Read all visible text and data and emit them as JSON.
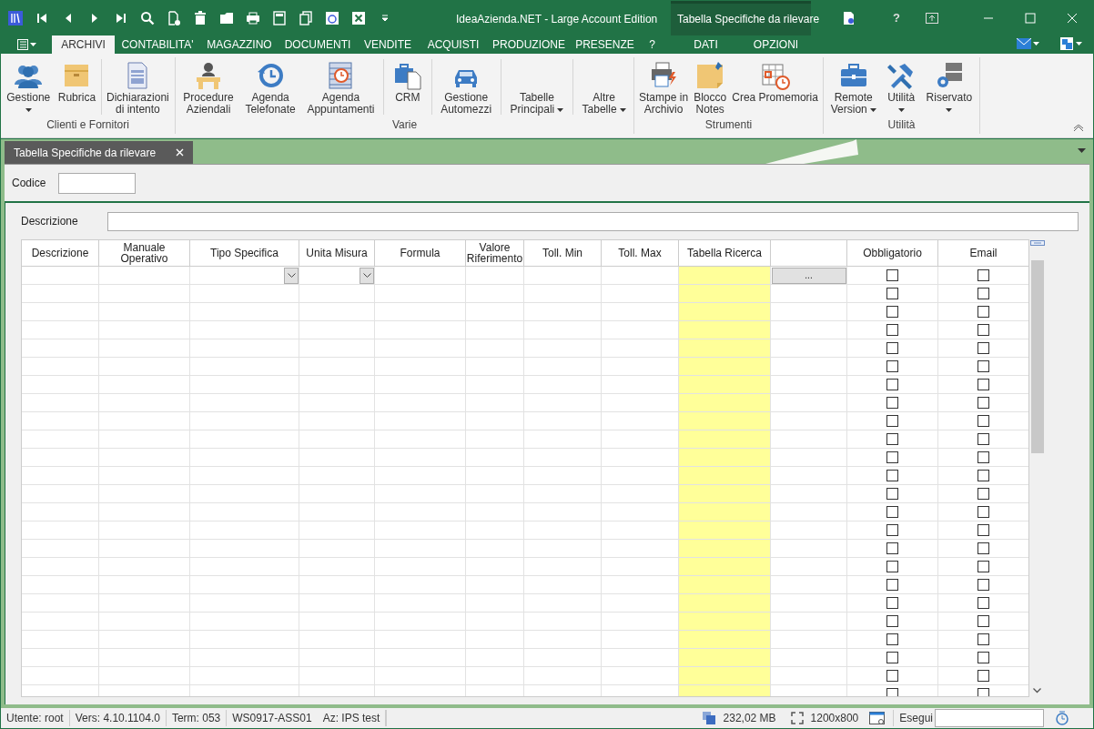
{
  "window": {
    "title": "IdeaAzienda.NET - Large Account Edition",
    "help": "?"
  },
  "context_tab_group": {
    "title": "Tabella Specifiche da rilevare",
    "tabs": [
      {
        "label": "DATI",
        "selected": false
      },
      {
        "label": "OPZIONI",
        "selected": false
      }
    ]
  },
  "ribbon_tabs": [
    {
      "label": "ARCHIVI",
      "selected": true
    },
    {
      "label": "CONTABILITA'",
      "selected": false
    },
    {
      "label": "MAGAZZINO",
      "selected": false
    },
    {
      "label": "DOCUMENTI",
      "selected": false
    },
    {
      "label": "VENDITE",
      "selected": false
    },
    {
      "label": "ACQUISTI",
      "selected": false
    },
    {
      "label": "PRODUZIONE",
      "selected": false
    },
    {
      "label": "PRESENZE",
      "selected": false
    },
    {
      "label": "?",
      "selected": false
    }
  ],
  "ribbon_groups": [
    {
      "label": "Clienti e Fornitori",
      "items": [
        {
          "lines": [
            "Gestione"
          ],
          "dropdown": true,
          "separated": false
        },
        {
          "lines": [
            "Rubrica"
          ],
          "dropdown": false,
          "separated": false
        },
        {
          "lines": [
            "Dichiarazioni",
            "di intento"
          ],
          "dropdown": false,
          "separated": true
        }
      ]
    },
    {
      "label": "Varie",
      "items": [
        {
          "lines": [
            "Procedure",
            "Aziendali"
          ],
          "dropdown": false,
          "separated": false
        },
        {
          "lines": [
            "Agenda",
            "Telefonate"
          ],
          "dropdown": false,
          "separated": false
        },
        {
          "lines": [
            "Agenda",
            "Appuntamenti"
          ],
          "dropdown": false,
          "separated": false
        },
        {
          "lines": [
            "CRM"
          ],
          "dropdown": false,
          "separated": true
        },
        {
          "lines": [
            "Gestione",
            "Automezzi"
          ],
          "dropdown": false,
          "separated": true
        },
        {
          "lines": [
            "Tabelle",
            "Principali"
          ],
          "dropdown": true,
          "separated": true
        },
        {
          "lines": [
            "Altre",
            "Tabelle"
          ],
          "dropdown": true,
          "separated": true
        }
      ]
    },
    {
      "label": "Strumenti",
      "items": [
        {
          "lines": [
            "Stampe in",
            "Archivio"
          ],
          "dropdown": false,
          "separated": false
        },
        {
          "lines": [
            "Blocco",
            "Notes"
          ],
          "dropdown": false,
          "separated": false
        },
        {
          "lines": [
            "Crea Promemoria"
          ],
          "dropdown": false,
          "separated": false
        }
      ]
    },
    {
      "label": "Utilità",
      "items": [
        {
          "lines": [
            "Remote",
            "Version"
          ],
          "dropdown": true,
          "separated": false
        },
        {
          "lines": [
            "Utilità"
          ],
          "dropdown": true,
          "separated": false
        },
        {
          "lines": [
            "Riservato"
          ],
          "dropdown": true,
          "separated": false
        }
      ]
    }
  ],
  "document_tabs": [
    {
      "label": "Tabella Specifiche da rilevare",
      "selected": true
    }
  ],
  "form": {
    "codice_label": "Codice",
    "descrizione_label": "Descrizione"
  },
  "grid": {
    "columns": [
      {
        "kind": "text",
        "label": "Descrizione",
        "highlighted": false
      },
      {
        "kind": "text",
        "label": "Manuale Operativo",
        "highlighted": false
      },
      {
        "kind": "combo",
        "label": "Tipo Specifica",
        "highlighted": false
      },
      {
        "kind": "combo",
        "label": "Unita Misura",
        "highlighted": false
      },
      {
        "kind": "text",
        "label": "Formula",
        "highlighted": false
      },
      {
        "kind": "text",
        "label": "Valore Riferimento",
        "highlighted": false
      },
      {
        "kind": "text",
        "label": "Toll. Min",
        "highlighted": false
      },
      {
        "kind": "text",
        "label": "Toll. Max",
        "highlighted": false
      },
      {
        "kind": "text",
        "label": "Tabella Ricerca",
        "highlighted": true
      },
      {
        "kind": "button",
        "highlighted": false
      },
      {
        "kind": "check",
        "label": "Obbligatorio",
        "highlighted": false
      },
      {
        "kind": "check",
        "label": "Email",
        "highlighted": false
      }
    ],
    "button_label": "...",
    "rows": [
      {
        "kind": "new",
        "checks": [
          false,
          false
        ]
      },
      {
        "kind": "empty",
        "checks": [
          false,
          false
        ]
      },
      {
        "kind": "empty",
        "checks": [
          false,
          false
        ]
      },
      {
        "kind": "empty",
        "checks": [
          false,
          false
        ]
      },
      {
        "kind": "empty",
        "checks": [
          false,
          false
        ]
      },
      {
        "kind": "empty",
        "checks": [
          false,
          false
        ]
      },
      {
        "kind": "empty",
        "checks": [
          false,
          false
        ]
      },
      {
        "kind": "empty",
        "checks": [
          false,
          false
        ]
      },
      {
        "kind": "empty",
        "checks": [
          false,
          false
        ]
      },
      {
        "kind": "empty",
        "checks": [
          false,
          false
        ]
      },
      {
        "kind": "empty",
        "checks": [
          false,
          false
        ]
      },
      {
        "kind": "empty",
        "checks": [
          false,
          false
        ]
      },
      {
        "kind": "empty",
        "checks": [
          false,
          false
        ]
      },
      {
        "kind": "empty",
        "checks": [
          false,
          false
        ]
      },
      {
        "kind": "empty",
        "checks": [
          false,
          false
        ]
      },
      {
        "kind": "empty",
        "checks": [
          false,
          false
        ]
      },
      {
        "kind": "empty",
        "checks": [
          false,
          false
        ]
      },
      {
        "kind": "empty",
        "checks": [
          false,
          false
        ]
      },
      {
        "kind": "empty",
        "checks": [
          false,
          false
        ]
      },
      {
        "kind": "empty",
        "checks": [
          false,
          false
        ]
      },
      {
        "kind": "empty",
        "checks": [
          false,
          false
        ]
      },
      {
        "kind": "empty",
        "checks": [
          false,
          false
        ]
      },
      {
        "kind": "empty",
        "checks": [
          false,
          false
        ]
      },
      {
        "kind": "empty",
        "checks": [
          false,
          false
        ]
      }
    ]
  },
  "status_bar": {
    "items": [
      "Utente: root",
      "Vers: 4.10.1104.0",
      "Term: 053",
      "WS0917-ASS01",
      "Az: IPS test"
    ],
    "memory": "232,02 MB",
    "resolution": "1200x800",
    "run_label": "Esegui"
  }
}
